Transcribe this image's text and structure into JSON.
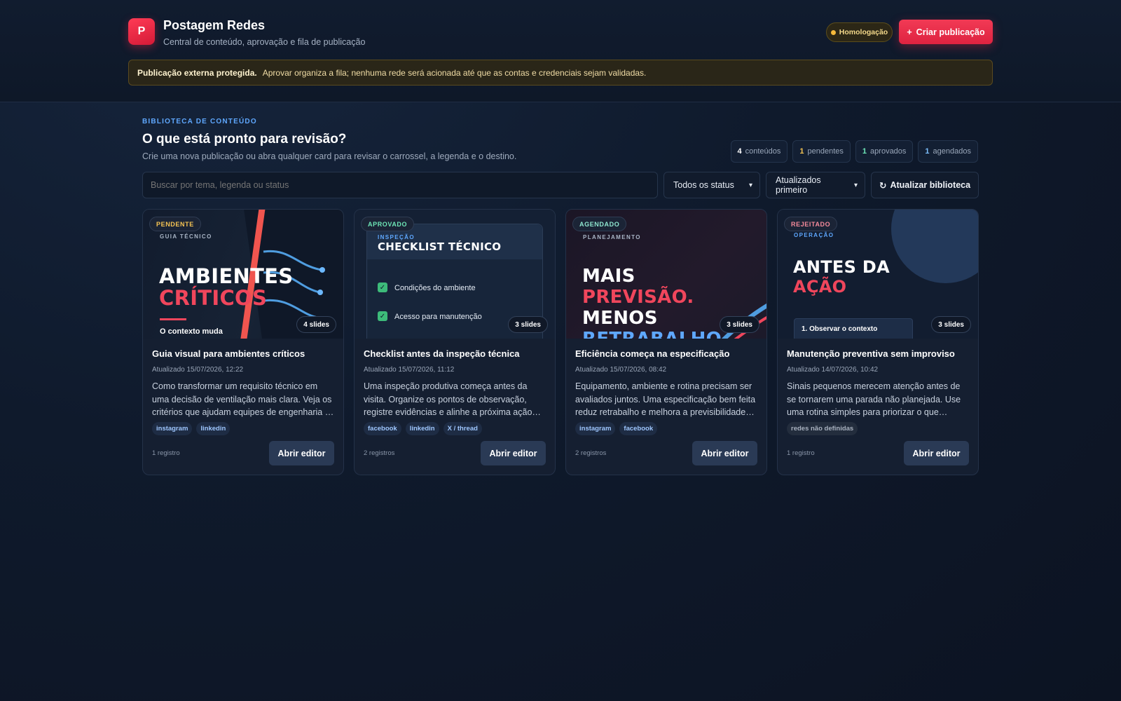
{
  "app": {
    "logo_letter": "P",
    "title": "Postagem Redes",
    "subtitle": "Central de conteúdo, aprovação e fila de publicação",
    "environment": "Homologação",
    "create_label": "Criar publicação",
    "create_icon": "+"
  },
  "alert": {
    "strong": "Publicação externa protegida.",
    "text": "Aprovar organiza a fila; nenhuma rede será acionada até que as contas e credenciais sejam validadas."
  },
  "library": {
    "eyebrow": "BIBLIOTECA DE CONTEÚDO",
    "title": "O que está pronto para revisão?",
    "subtitle": "Crie uma nova publicação ou abra qualquer card para revisar o carrossel, a legenda e o destino.",
    "stats": [
      {
        "n": "4",
        "label": "conteúdos"
      },
      {
        "n": "1",
        "label": "pendentes"
      },
      {
        "n": "1",
        "label": "aprovados"
      },
      {
        "n": "1",
        "label": "agendados"
      }
    ],
    "search_placeholder": "Buscar por tema, legenda ou status",
    "status_filter": "Todos os status",
    "sort": "Atualizados primeiro",
    "refresh_icon": "↻",
    "refresh_label": "Atualizar biblioteca"
  },
  "cards": [
    {
      "status": "PENDENTE",
      "kicker": "GUIA TÉCNICO",
      "headline_1": "AMBIENTES",
      "headline_2": "CRÍTICOS",
      "tagline": "O contexto muda",
      "slides": "4 slides",
      "title": "Guia visual para ambientes críticos",
      "date": "Atualizado 15/07/2026, 12:22",
      "desc": "Como transformar um requisito técnico em uma decisão de ventilação mais clara. Veja os critérios que ajudam equipes de engenharia a escolher com mais segurança.",
      "tags": [
        "instagram",
        "linkedin"
      ],
      "records": "1 registro",
      "open_label": "Abrir editor"
    },
    {
      "status": "APROVADO",
      "kicker": "INSPEÇÃO",
      "headline_1": "CHECKLIST TÉCNICO",
      "check_1": "Condições do ambiente",
      "check_2": "Acesso para manutenção",
      "slides": "3 slides",
      "title": "Checklist antes da inspeção técnica",
      "date": "Atualizado 15/07/2026, 11:12",
      "desc": "Uma inspeção produtiva começa antes da visita. Organize os pontos de observação, registre evidências e alinhe a próxima ação com a equipe.",
      "tags": [
        "facebook",
        "linkedin",
        "X / thread"
      ],
      "records": "2 registros",
      "open_label": "Abrir editor"
    },
    {
      "status": "AGENDADO",
      "kicker": "PLANEJAMENTO",
      "headline_1": "MAIS",
      "headline_2": "PREVISÃO.",
      "headline_3": "MENOS",
      "headline_4": "RETRABALHO",
      "slides": "3 slides",
      "title": "Eficiência começa na especificação",
      "date": "Atualizado 15/07/2026, 08:42",
      "desc": "Equipamento, ambiente e rotina precisam ser avaliados juntos. Uma especificação bem feita reduz retrabalho e melhora a previsibilidade da operação.",
      "tags": [
        "instagram",
        "facebook"
      ],
      "records": "2 registros",
      "open_label": "Abrir editor"
    },
    {
      "status": "REJEITADO",
      "kicker": "OPERAÇÃO",
      "headline_1": "ANTES DA",
      "headline_2": "AÇÃO",
      "step": "1. Observar o contexto",
      "slides": "3 slides",
      "title": "Manutenção preventiva sem improviso",
      "date": "Atualizado 14/07/2026, 10:42",
      "desc": "Sinais pequenos merecem atenção antes de se tornarem uma parada não planejada. Use uma rotina simples para priorizar o que precisa de cuidado.",
      "tags": [
        "redes não definidas"
      ],
      "records": "1 registro",
      "open_label": "Abrir editor"
    }
  ]
}
